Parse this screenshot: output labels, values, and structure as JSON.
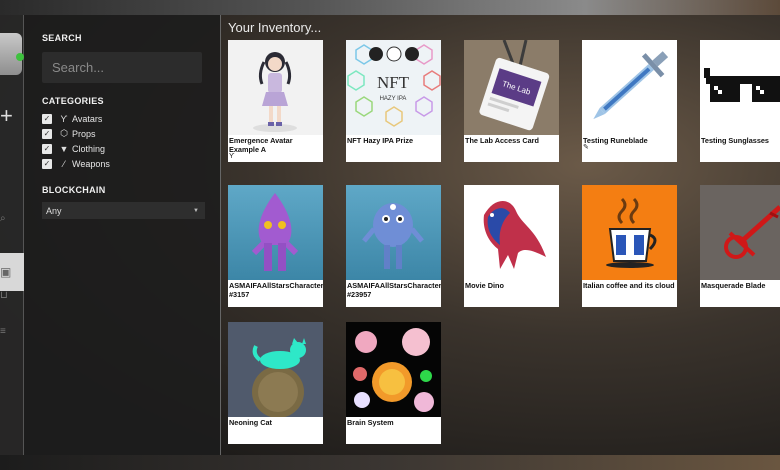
{
  "sidebar": {
    "search_title": "SEARCH",
    "search_placeholder": "Search...",
    "categories_title": "CATEGORIES",
    "categories": [
      {
        "label": "Avatars",
        "checked": true,
        "icon": "avatar-icon"
      },
      {
        "label": "Props",
        "checked": true,
        "icon": "cube-icon"
      },
      {
        "label": "Clothing",
        "checked": true,
        "icon": "shirt-icon"
      },
      {
        "label": "Weapons",
        "checked": true,
        "icon": "sword-icon"
      }
    ],
    "blockchain_title": "BLOCKCHAIN",
    "blockchain_value": "Any"
  },
  "main": {
    "title": "Your Inventory...",
    "items": [
      {
        "name": "Emergence Avatar Example A"
      },
      {
        "name": "NFT Hazy IPA Prize"
      },
      {
        "name": "The Lab Access Card"
      },
      {
        "name": "Testing Runeblade"
      },
      {
        "name": "Testing Sunglasses"
      },
      {
        "name": "ASMAIFAAllStarsCharacter #3157"
      },
      {
        "name": "ASMAIFAAllStarsCharacter #23957"
      },
      {
        "name": "Movie Dino"
      },
      {
        "name": "Italian coffee and its cloud"
      },
      {
        "name": "Masquerade Blade"
      },
      {
        "name": "Neoning Cat"
      },
      {
        "name": "Brain System"
      }
    ]
  },
  "thumb_texts": {
    "nft": "NFT",
    "hazy": "HAZY IPA",
    "lab": "The Lab"
  },
  "colors": {
    "accent_online": "#3ec23e",
    "card_bg": "#ffffff",
    "sidebar_bg": "#1c1c1c"
  }
}
